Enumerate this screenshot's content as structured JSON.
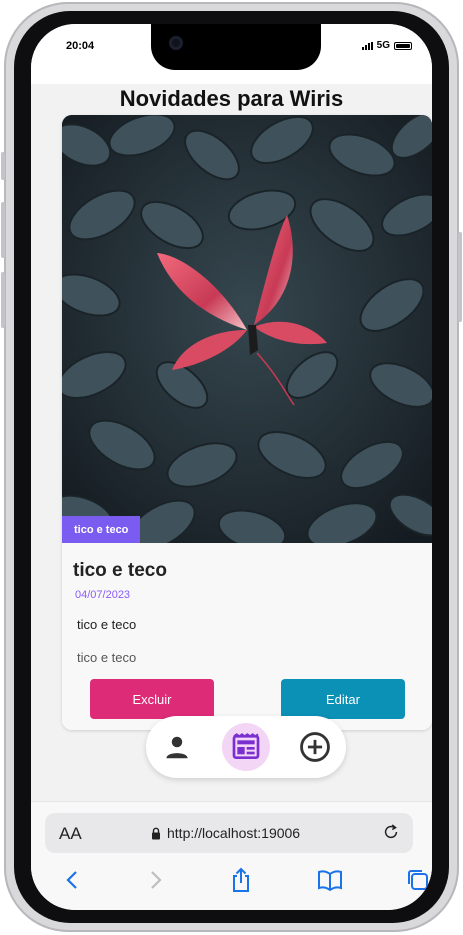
{
  "status_bar": {
    "time": "20:04",
    "network": "5G"
  },
  "page": {
    "title": "Novidades para Wiris"
  },
  "card": {
    "image_description": "dark leaves with a pink butterfly",
    "tag": "tico e teco",
    "title": "tico e teco",
    "date": "04/07/2023",
    "description": "tico e teco",
    "extra": "tico e teco",
    "delete_label": "Excluir",
    "edit_label": "Editar"
  },
  "bottom_nav": {
    "items": [
      {
        "icon": "person-icon",
        "active": false
      },
      {
        "icon": "feed-icon",
        "active": true
      },
      {
        "icon": "add-circle-icon",
        "active": false
      }
    ]
  },
  "browser": {
    "text_size_label": "AA",
    "url": "http://localhost:19006"
  },
  "colors": {
    "accent": "#7b5cf0",
    "date": "#8b5cf6",
    "delete": "#dd2b78",
    "edit": "#0b90b6",
    "nav_active_bg": "#f3d6f5"
  }
}
